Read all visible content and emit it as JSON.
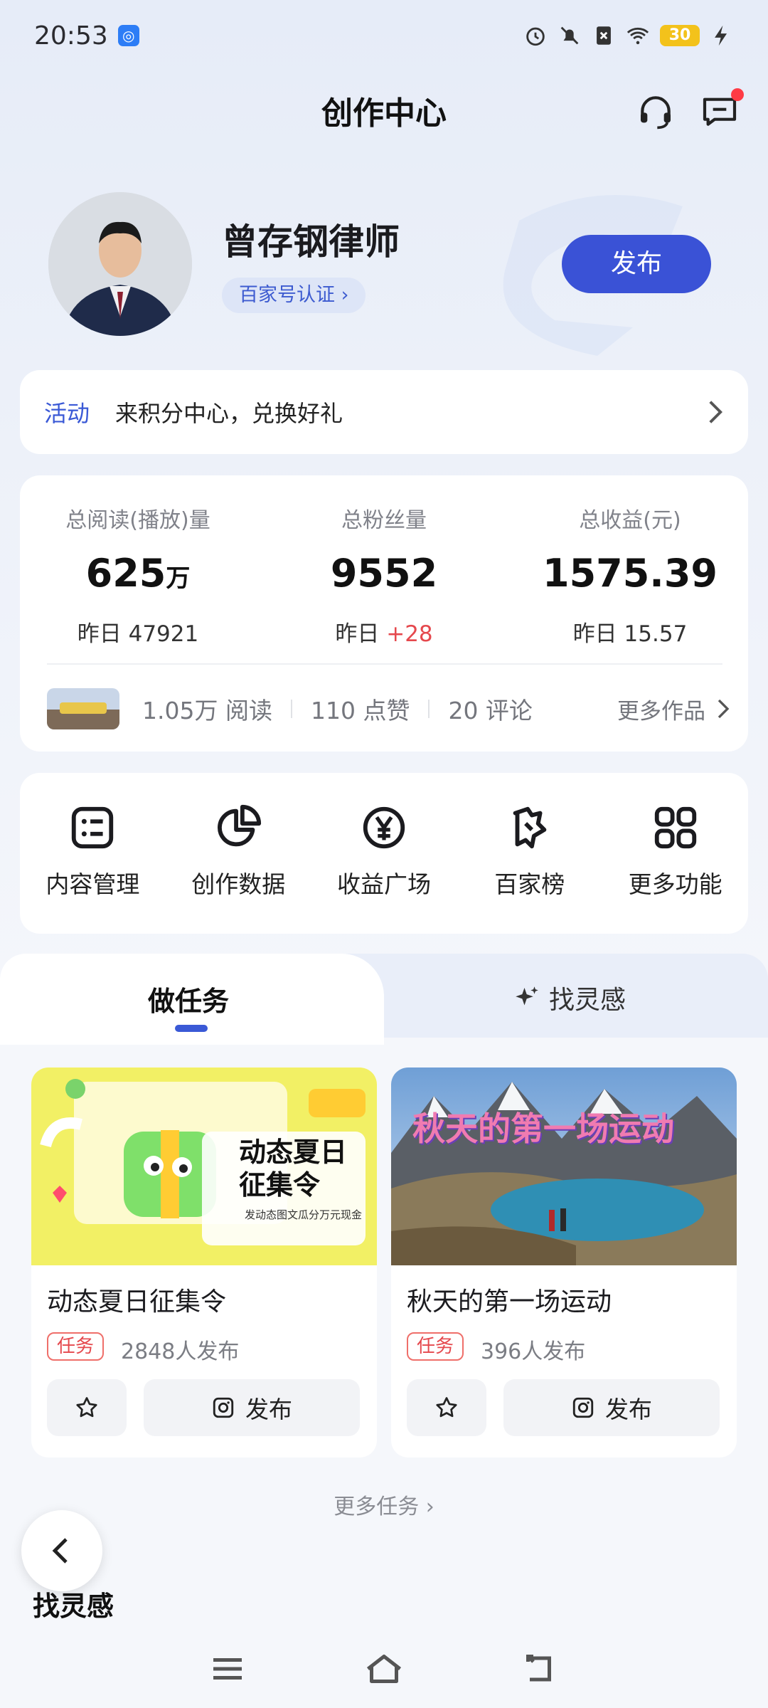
{
  "status_bar": {
    "time": "20:53",
    "battery": "30",
    "icons": [
      "alarm-icon",
      "mute-icon",
      "no-sim-icon",
      "wifi-icon",
      "charging-icon"
    ]
  },
  "header": {
    "title": "创作中心",
    "icons": [
      "headset-icon",
      "message-icon"
    ]
  },
  "profile": {
    "name": "曾存钢律师",
    "verify_label": "百家号认证",
    "publish_label": "发布"
  },
  "activity": {
    "tag": "活动",
    "text": "来积分中心，兑换好礼"
  },
  "stats": {
    "reads": {
      "label": "总阅读(播放)量",
      "value": "625",
      "unit": "万",
      "yesterday_prefix": "昨日",
      "yesterday_value": "47921"
    },
    "fans": {
      "label": "总粉丝量",
      "value": "9552",
      "yesterday_prefix": "昨日",
      "yesterday_value": "+28"
    },
    "income": {
      "label": "总收益(元)",
      "value": "1575.39",
      "yesterday_prefix": "昨日",
      "yesterday_value": "15.57"
    }
  },
  "latest_work": {
    "reads": "1.05万 阅读",
    "likes": "110 点赞",
    "comments": "20 评论",
    "more_label": "更多作品"
  },
  "tools": [
    {
      "label": "内容管理",
      "icon": "list-icon"
    },
    {
      "label": "创作数据",
      "icon": "pie-chart-icon"
    },
    {
      "label": "收益广场",
      "icon": "yen-icon"
    },
    {
      "label": "百家榜",
      "icon": "badge-icon"
    },
    {
      "label": "更多功能",
      "icon": "grid-icon"
    }
  ],
  "tabs": {
    "active": "做任务",
    "inactive": "找灵感"
  },
  "tasks": [
    {
      "title": "动态夏日征集令",
      "badge": "任务",
      "count": "2848人发布",
      "publish_label": "发布",
      "image_text": "动态夏日征集令",
      "image_sub": "发动态图文瓜分万元现金"
    },
    {
      "title": "秋天的第一场运动",
      "badge": "任务",
      "count": "396人发布",
      "publish_label": "发布",
      "image_text": "秋天的第一场运动"
    }
  ],
  "more_tasks_label": "更多任务",
  "inspire_title": "找灵感",
  "colors": {
    "accent": "#3a52d6",
    "red": "#e5484d"
  }
}
